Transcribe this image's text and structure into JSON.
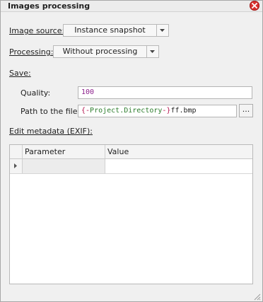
{
  "window": {
    "title": "Images processing"
  },
  "image_source": {
    "label": "Image source:",
    "value": "Instance snapshot"
  },
  "processing": {
    "label": "Processing:",
    "value": "Without processing"
  },
  "save": {
    "label": "Save:",
    "quality_label": "Quality:",
    "quality_value": "100",
    "path_label": "Path to the file:",
    "path": {
      "open": "{-",
      "variable": "Project.Directory",
      "close": "-}",
      "suffix": "ff.bmp"
    },
    "browse_label": "..."
  },
  "metadata": {
    "label": "Edit metadata (EXIF):",
    "columns": [
      "Parameter",
      "Value"
    ],
    "rows": [
      {
        "parameter": "",
        "value": ""
      }
    ]
  },
  "colors": {
    "close_button": "#d9312f",
    "window_bg": "#f0f0f0",
    "number": "#8b1e8b",
    "brace": "#b4154f",
    "variable": "#2d7d2d"
  }
}
